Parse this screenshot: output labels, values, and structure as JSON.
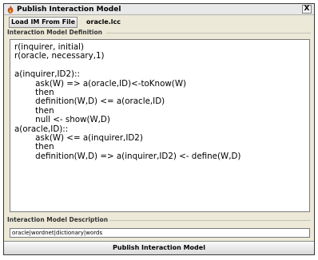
{
  "window": {
    "title": "Publish Interaction Model",
    "close_glyph": "X",
    "app_icon": "app-icon"
  },
  "toolbar": {
    "load_button_label": "Load IM From File",
    "file_name": "oracle.lcc"
  },
  "definition": {
    "section_label": "Interaction Model Definition",
    "lines": [
      "r(inquirer, initial)",
      "r(oracle, necessary,1)",
      "",
      "a(inquirer,ID2)::",
      "        ask(W) => a(oracle,ID)<-toKnow(W)",
      "        then",
      "        definition(W,D) <= a(oracle,ID)",
      "        then",
      "        null <- show(W,D)",
      "a(oracle,ID)::",
      "        ask(W) <= a(inquirer,ID2)",
      "        then",
      "        definition(W,D) => a(inquirer,ID2) <- define(W,D)",
      "",
      "",
      "",
      "",
      ""
    ]
  },
  "description": {
    "section_label": "Interaction Model Description",
    "value": "oracle|wordnet|dictionary|words"
  },
  "footer": {
    "publish_button_label": "Publish Interaction Model"
  }
}
